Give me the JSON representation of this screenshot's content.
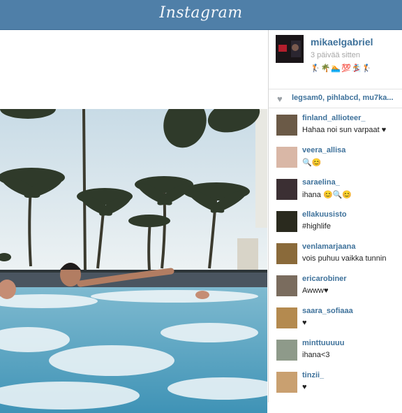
{
  "app": {
    "title": "Instagram"
  },
  "post": {
    "owner": {
      "username": "mikaelgabriel",
      "time": "3 päivää sitten",
      "caption": "🏌🌴🏊💯🏂🏌",
      "avatar_icon": "profile-photo-icon"
    },
    "likes": {
      "icon": "heart-icon",
      "text": "legsam0, pihlabcd, mu7ka..."
    },
    "comments": [
      {
        "username": "finland_allioteer_",
        "text": "Hahaa noi sun varpaat ♥",
        "avatar_color": "#6b5a47"
      },
      {
        "username": "veera_allisa",
        "text": "🔍😊",
        "avatar_color": "#d9b7a6"
      },
      {
        "username": "saraelina_",
        "text": "ihana 😊🔍😊",
        "avatar_color": "#3b2f33"
      },
      {
        "username": "ellakuusisto",
        "text": "#highlife",
        "avatar_color": "#2a2a1e"
      },
      {
        "username": "venlamarjaana",
        "text": "vois puhuu vaikka tunnin",
        "avatar_color": "#8a6a3a"
      },
      {
        "username": "ericarobiner",
        "text": "Awww♥",
        "avatar_color": "#7a6c5e"
      },
      {
        "username": "saara_sofiaaa",
        "text": "♥",
        "avatar_color": "#b48a4f"
      },
      {
        "username": "minttuuuuu",
        "text": "ihana<3",
        "avatar_color": "#8e9a8a"
      },
      {
        "username": "tinzii_",
        "text": "♥",
        "avatar_color": "#c9a070"
      }
    ]
  },
  "colors": {
    "header": "#4f7fa8",
    "username": "#3f729b",
    "sky": "#dfe9ee",
    "water": "#5ba7c4"
  }
}
